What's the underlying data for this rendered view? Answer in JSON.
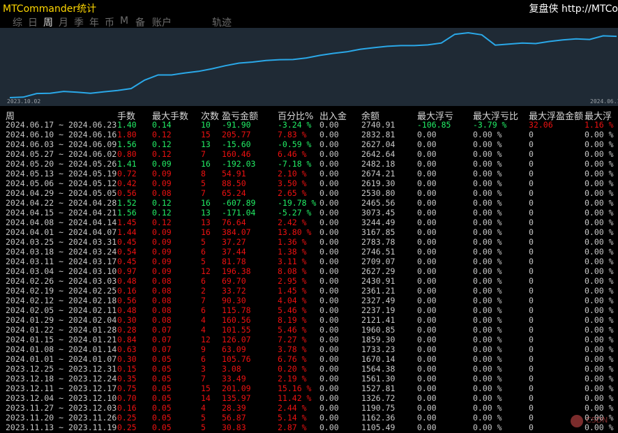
{
  "app": {
    "title": "MTCommander统计",
    "brand": "复盘侠 http://MTCo"
  },
  "tabs": [
    {
      "label": "综",
      "active": false
    },
    {
      "label": "日",
      "active": false
    },
    {
      "label": "周",
      "active": true
    },
    {
      "label": "月",
      "active": false
    },
    {
      "label": "季",
      "active": false
    },
    {
      "label": "年",
      "active": false
    },
    {
      "label": "币",
      "active": false
    },
    {
      "label": "M",
      "active": false
    },
    {
      "label": "备",
      "active": false
    },
    {
      "label": "账户",
      "active": false
    },
    {
      "label": "轨迹",
      "active": false
    }
  ],
  "chart_data": {
    "type": "line",
    "x_start_label": "2023.10.02",
    "x_end_label": "2024.06.17",
    "line_color": "#2aa8e8",
    "background": "#1f2a35",
    "values": [
      0,
      50,
      400,
      420,
      600,
      520,
      420,
      570,
      700,
      880,
      1700,
      2200,
      2200,
      2400,
      2550,
      2800,
      3100,
      3350,
      3450,
      3600,
      3680,
      3700,
      3850,
      4100,
      4300,
      4450,
      4700,
      4850,
      4980,
      5050,
      5050,
      5120,
      5300,
      6150,
      6300,
      6100,
      5100,
      5200,
      5300,
      5250,
      5450,
      5600,
      5700,
      5650,
      6000,
      5950
    ],
    "ylim": [
      0,
      6500
    ]
  },
  "table": {
    "headers": [
      "周",
      "手数",
      "最大手数",
      "次数",
      "盈亏金额",
      "百分比%",
      "出入金",
      "余额",
      "最大浮亏",
      "最大浮亏比",
      "最大浮盈金额",
      "最大浮"
    ],
    "rows": [
      {
        "date": "2024.06.17 ~ 2024.06.23",
        "lots": "1.40",
        "maxlot": "0.14",
        "cnt": "10",
        "pnl": "-91.90",
        "pct": "-3.24 %",
        "io": "0.00",
        "bal": "2740.91",
        "mdd": "-106.85",
        "mddp": "-3.79 %",
        "mfe": "32.06",
        "mfep": "1.16 %",
        "sign": "neg",
        "mdd_sign": "neg",
        "mfe_sign": "pos"
      },
      {
        "date": "2024.06.10 ~ 2024.06.16",
        "lots": "1.80",
        "maxlot": "0.12",
        "cnt": "15",
        "pnl": "205.77",
        "pct": "7.83 %",
        "io": "0.00",
        "bal": "2832.81",
        "mdd": "0.00",
        "mddp": "0.00 %",
        "mfe": "0",
        "mfep": "0.00 %",
        "sign": "pos",
        "mdd_sign": "neu",
        "mfe_sign": "neu"
      },
      {
        "date": "2024.06.03 ~ 2024.06.09",
        "lots": "1.56",
        "maxlot": "0.12",
        "cnt": "13",
        "pnl": "-15.60",
        "pct": "-0.59 %",
        "io": "0.00",
        "bal": "2627.04",
        "mdd": "0.00",
        "mddp": "0.00 %",
        "mfe": "0",
        "mfep": "0.00 %",
        "sign": "neg",
        "mdd_sign": "neu",
        "mfe_sign": "neu"
      },
      {
        "date": "2024.05.27 ~ 2024.06.02",
        "lots": "0.80",
        "maxlot": "0.12",
        "cnt": "7",
        "pnl": "160.46",
        "pct": "6.46 %",
        "io": "0.00",
        "bal": "2642.64",
        "mdd": "0.00",
        "mddp": "0.00 %",
        "mfe": "0",
        "mfep": "0.00 %",
        "sign": "pos",
        "mdd_sign": "neu",
        "mfe_sign": "neu"
      },
      {
        "date": "2024.05.20 ~ 2024.05.26",
        "lots": "1.41",
        "maxlot": "0.09",
        "cnt": "16",
        "pnl": "-192.03",
        "pct": "-7.18 %",
        "io": "0.00",
        "bal": "2482.18",
        "mdd": "0.00",
        "mddp": "0.00 %",
        "mfe": "0",
        "mfep": "0.00 %",
        "sign": "neg",
        "mdd_sign": "neu",
        "mfe_sign": "neu"
      },
      {
        "date": "2024.05.13 ~ 2024.05.19",
        "lots": "0.72",
        "maxlot": "0.09",
        "cnt": "8",
        "pnl": "54.91",
        "pct": "2.10 %",
        "io": "0.00",
        "bal": "2674.21",
        "mdd": "0.00",
        "mddp": "0.00 %",
        "mfe": "0",
        "mfep": "0.00 %",
        "sign": "pos",
        "mdd_sign": "neu",
        "mfe_sign": "neu"
      },
      {
        "date": "2024.05.06 ~ 2024.05.12",
        "lots": "0.42",
        "maxlot": "0.09",
        "cnt": "5",
        "pnl": "88.50",
        "pct": "3.50 %",
        "io": "0.00",
        "bal": "2619.30",
        "mdd": "0.00",
        "mddp": "0.00 %",
        "mfe": "0",
        "mfep": "0.00 %",
        "sign": "pos",
        "mdd_sign": "neu",
        "mfe_sign": "neu"
      },
      {
        "date": "2024.04.29 ~ 2024.05.05",
        "lots": "0.56",
        "maxlot": "0.08",
        "cnt": "7",
        "pnl": "65.24",
        "pct": "2.65 %",
        "io": "0.00",
        "bal": "2530.80",
        "mdd": "0.00",
        "mddp": "0.00 %",
        "mfe": "0",
        "mfep": "0.00 %",
        "sign": "pos",
        "mdd_sign": "neu",
        "mfe_sign": "neu"
      },
      {
        "date": "2024.04.22 ~ 2024.04.28",
        "lots": "1.52",
        "maxlot": "0.12",
        "cnt": "16",
        "pnl": "-607.89",
        "pct": "-19.78 %",
        "io": "0.00",
        "bal": "2465.56",
        "mdd": "0.00",
        "mddp": "0.00 %",
        "mfe": "0",
        "mfep": "0.00 %",
        "sign": "neg",
        "mdd_sign": "neu",
        "mfe_sign": "neu"
      },
      {
        "date": "2024.04.15 ~ 2024.04.21",
        "lots": "1.56",
        "maxlot": "0.12",
        "cnt": "13",
        "pnl": "-171.04",
        "pct": "-5.27 %",
        "io": "0.00",
        "bal": "3073.45",
        "mdd": "0.00",
        "mddp": "0.00 %",
        "mfe": "0",
        "mfep": "0.00 %",
        "sign": "neg",
        "mdd_sign": "neu",
        "mfe_sign": "neu"
      },
      {
        "date": "2024.04.08 ~ 2024.04.14",
        "lots": "1.45",
        "maxlot": "0.12",
        "cnt": "13",
        "pnl": "76.64",
        "pct": "2.42 %",
        "io": "0.00",
        "bal": "3244.49",
        "mdd": "0.00",
        "mddp": "0.00 %",
        "mfe": "0",
        "mfep": "0.00 %",
        "sign": "pos",
        "mdd_sign": "neu",
        "mfe_sign": "neu"
      },
      {
        "date": "2024.04.01 ~ 2024.04.07",
        "lots": "1.44",
        "maxlot": "0.09",
        "cnt": "16",
        "pnl": "384.07",
        "pct": "13.80 %",
        "io": "0.00",
        "bal": "3167.85",
        "mdd": "0.00",
        "mddp": "0.00 %",
        "mfe": "0",
        "mfep": "0.00 %",
        "sign": "pos",
        "mdd_sign": "neu",
        "mfe_sign": "neu"
      },
      {
        "date": "2024.03.25 ~ 2024.03.31",
        "lots": "0.45",
        "maxlot": "0.09",
        "cnt": "5",
        "pnl": "37.27",
        "pct": "1.36 %",
        "io": "0.00",
        "bal": "2783.78",
        "mdd": "0.00",
        "mddp": "0.00 %",
        "mfe": "0",
        "mfep": "0.00 %",
        "sign": "pos",
        "mdd_sign": "neu",
        "mfe_sign": "neu"
      },
      {
        "date": "2024.03.18 ~ 2024.03.24",
        "lots": "0.54",
        "maxlot": "0.09",
        "cnt": "6",
        "pnl": "37.44",
        "pct": "1.38 %",
        "io": "0.00",
        "bal": "2746.51",
        "mdd": "0.00",
        "mddp": "0.00 %",
        "mfe": "0",
        "mfep": "0.00 %",
        "sign": "pos",
        "mdd_sign": "neu",
        "mfe_sign": "neu"
      },
      {
        "date": "2024.03.11 ~ 2024.03.17",
        "lots": "0.45",
        "maxlot": "0.09",
        "cnt": "5",
        "pnl": "81.78",
        "pct": "3.11 %",
        "io": "0.00",
        "bal": "2709.07",
        "mdd": "0.00",
        "mddp": "0.00 %",
        "mfe": "0",
        "mfep": "0.00 %",
        "sign": "pos",
        "mdd_sign": "neu",
        "mfe_sign": "neu"
      },
      {
        "date": "2024.03.04 ~ 2024.03.10",
        "lots": "0.97",
        "maxlot": "0.09",
        "cnt": "12",
        "pnl": "196.38",
        "pct": "8.08 %",
        "io": "0.00",
        "bal": "2627.29",
        "mdd": "0.00",
        "mddp": "0.00 %",
        "mfe": "0",
        "mfep": "0.00 %",
        "sign": "pos",
        "mdd_sign": "neu",
        "mfe_sign": "neu"
      },
      {
        "date": "2024.02.26 ~ 2024.03.03",
        "lots": "0.48",
        "maxlot": "0.08",
        "cnt": "6",
        "pnl": "69.70",
        "pct": "2.95 %",
        "io": "0.00",
        "bal": "2430.91",
        "mdd": "0.00",
        "mddp": "0.00 %",
        "mfe": "0",
        "mfep": "0.00 %",
        "sign": "pos",
        "mdd_sign": "neu",
        "mfe_sign": "neu"
      },
      {
        "date": "2024.02.19 ~ 2024.02.25",
        "lots": "0.16",
        "maxlot": "0.08",
        "cnt": "2",
        "pnl": "33.72",
        "pct": "1.45 %",
        "io": "0.00",
        "bal": "2361.21",
        "mdd": "0.00",
        "mddp": "0.00 %",
        "mfe": "0",
        "mfep": "0.00 %",
        "sign": "pos",
        "mdd_sign": "neu",
        "mfe_sign": "neu"
      },
      {
        "date": "2024.02.12 ~ 2024.02.18",
        "lots": "0.56",
        "maxlot": "0.08",
        "cnt": "7",
        "pnl": "90.30",
        "pct": "4.04 %",
        "io": "0.00",
        "bal": "2327.49",
        "mdd": "0.00",
        "mddp": "0.00 %",
        "mfe": "0",
        "mfep": "0.00 %",
        "sign": "pos",
        "mdd_sign": "neu",
        "mfe_sign": "neu"
      },
      {
        "date": "2024.02.05 ~ 2024.02.11",
        "lots": "0.48",
        "maxlot": "0.08",
        "cnt": "6",
        "pnl": "115.78",
        "pct": "5.46 %",
        "io": "0.00",
        "bal": "2237.19",
        "mdd": "0.00",
        "mddp": "0.00 %",
        "mfe": "0",
        "mfep": "0.00 %",
        "sign": "pos",
        "mdd_sign": "neu",
        "mfe_sign": "neu"
      },
      {
        "date": "2024.01.29 ~ 2024.02.04",
        "lots": "0.30",
        "maxlot": "0.08",
        "cnt": "4",
        "pnl": "160.56",
        "pct": "8.19 %",
        "io": "0.00",
        "bal": "2121.41",
        "mdd": "0.00",
        "mddp": "0.00 %",
        "mfe": "0",
        "mfep": "0.00 %",
        "sign": "pos",
        "mdd_sign": "neu",
        "mfe_sign": "neu"
      },
      {
        "date": "2024.01.22 ~ 2024.01.28",
        "lots": "0.28",
        "maxlot": "0.07",
        "cnt": "4",
        "pnl": "101.55",
        "pct": "5.46 %",
        "io": "0.00",
        "bal": "1960.85",
        "mdd": "0.00",
        "mddp": "0.00 %",
        "mfe": "0",
        "mfep": "0.00 %",
        "sign": "pos",
        "mdd_sign": "neu",
        "mfe_sign": "neu"
      },
      {
        "date": "2024.01.15 ~ 2024.01.21",
        "lots": "0.84",
        "maxlot": "0.07",
        "cnt": "12",
        "pnl": "126.07",
        "pct": "7.27 %",
        "io": "0.00",
        "bal": "1859.30",
        "mdd": "0.00",
        "mddp": "0.00 %",
        "mfe": "0",
        "mfep": "0.00 %",
        "sign": "pos",
        "mdd_sign": "neu",
        "mfe_sign": "neu"
      },
      {
        "date": "2024.01.08 ~ 2024.01.14",
        "lots": "0.63",
        "maxlot": "0.07",
        "cnt": "9",
        "pnl": "63.09",
        "pct": "3.78 %",
        "io": "0.00",
        "bal": "1733.23",
        "mdd": "0.00",
        "mddp": "0.00 %",
        "mfe": "0",
        "mfep": "0.00 %",
        "sign": "pos",
        "mdd_sign": "neu",
        "mfe_sign": "neu"
      },
      {
        "date": "2024.01.01 ~ 2024.01.07",
        "lots": "0.30",
        "maxlot": "0.05",
        "cnt": "6",
        "pnl": "105.76",
        "pct": "6.76 %",
        "io": "0.00",
        "bal": "1670.14",
        "mdd": "0.00",
        "mddp": "0.00 %",
        "mfe": "0",
        "mfep": "0.00 %",
        "sign": "pos",
        "mdd_sign": "neu",
        "mfe_sign": "neu"
      },
      {
        "date": "2023.12.25 ~ 2023.12.31",
        "lots": "0.15",
        "maxlot": "0.05",
        "cnt": "3",
        "pnl": "3.08",
        "pct": "0.20 %",
        "io": "0.00",
        "bal": "1564.38",
        "mdd": "0.00",
        "mddp": "0.00 %",
        "mfe": "0",
        "mfep": "0.00 %",
        "sign": "pos",
        "mdd_sign": "neu",
        "mfe_sign": "neu"
      },
      {
        "date": "2023.12.18 ~ 2023.12.24",
        "lots": "0.35",
        "maxlot": "0.05",
        "cnt": "7",
        "pnl": "33.49",
        "pct": "2.19 %",
        "io": "0.00",
        "bal": "1561.30",
        "mdd": "0.00",
        "mddp": "0.00 %",
        "mfe": "0",
        "mfep": "0.00 %",
        "sign": "pos",
        "mdd_sign": "neu",
        "mfe_sign": "neu"
      },
      {
        "date": "2023.12.11 ~ 2023.12.17",
        "lots": "0.75",
        "maxlot": "0.05",
        "cnt": "15",
        "pnl": "201.09",
        "pct": "15.16 %",
        "io": "0.00",
        "bal": "1527.81",
        "mdd": "0.00",
        "mddp": "0.00 %",
        "mfe": "0",
        "mfep": "0.00 %",
        "sign": "pos",
        "mdd_sign": "neu",
        "mfe_sign": "neu"
      },
      {
        "date": "2023.12.04 ~ 2023.12.10",
        "lots": "0.70",
        "maxlot": "0.05",
        "cnt": "14",
        "pnl": "135.97",
        "pct": "11.42 %",
        "io": "0.00",
        "bal": "1326.72",
        "mdd": "0.00",
        "mddp": "0.00 %",
        "mfe": "0",
        "mfep": "0.00 %",
        "sign": "pos",
        "mdd_sign": "neu",
        "mfe_sign": "neu"
      },
      {
        "date": "2023.11.27 ~ 2023.12.03",
        "lots": "0.16",
        "maxlot": "0.05",
        "cnt": "4",
        "pnl": "28.39",
        "pct": "2.44 %",
        "io": "0.00",
        "bal": "1190.75",
        "mdd": "0.00",
        "mddp": "0.00 %",
        "mfe": "0",
        "mfep": "0.00 %",
        "sign": "pos",
        "mdd_sign": "neu",
        "mfe_sign": "neu"
      },
      {
        "date": "2023.11.20 ~ 2023.11.26",
        "lots": "0.25",
        "maxlot": "0.05",
        "cnt": "5",
        "pnl": "56.87",
        "pct": "5.14 %",
        "io": "0.00",
        "bal": "1162.36",
        "mdd": "0.00",
        "mddp": "0.00 %",
        "mfe": "0",
        "mfep": "0.00 %",
        "sign": "pos",
        "mdd_sign": "neu",
        "mfe_sign": "neu"
      },
      {
        "date": "2023.11.13 ~ 2023.11.19",
        "lots": "0.25",
        "maxlot": "0.05",
        "cnt": "5",
        "pnl": "30.83",
        "pct": "2.87 %",
        "io": "0.00",
        "bal": "1105.49",
        "mdd": "0.00",
        "mddp": "0.00 %",
        "mfe": "0",
        "mfep": "0.00 %",
        "sign": "pos",
        "mdd_sign": "neu",
        "mfe_sign": "neu"
      }
    ]
  },
  "watermark": {
    "text": "CSDN"
  },
  "colors": {
    "positive": "#ee1111",
    "negative": "#22ee66",
    "line": "#2aa8e8"
  }
}
